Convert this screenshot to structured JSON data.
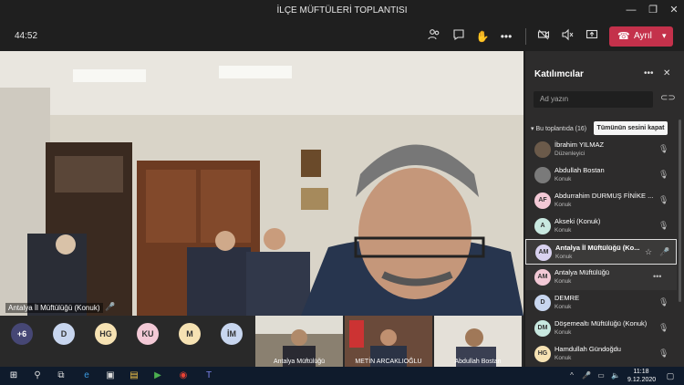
{
  "window": {
    "title": "İLÇE MÜFTÜLERİ TOPLANTISI"
  },
  "toolbar": {
    "timer": "44:52",
    "leave_label": "Ayrıl"
  },
  "stage": {
    "main_video_label": "Antalya İl Müftülüğü (Konuk)",
    "overflow_count": "+6",
    "bubbles": [
      {
        "initials": "D",
        "color": "#c8d6ef"
      },
      {
        "initials": "HG",
        "color": "#f6e2b3"
      },
      {
        "initials": "KU",
        "color": "#f3c9d6"
      },
      {
        "initials": "M",
        "color": "#f6e2b3"
      },
      {
        "initials": "İM",
        "color": "#c8d6ef"
      }
    ],
    "thumbnails": [
      {
        "label": "Antalya Müftülüğü"
      },
      {
        "label": "METİN ARCAKLIOĞLU"
      },
      {
        "label": "Abdullah Bostan"
      }
    ]
  },
  "panel": {
    "title": "Katılımcılar",
    "search_placeholder": "Ad yazın",
    "section_heading": "Bu toplantıda (16)",
    "mute_all_label": "Tümünün sesini kapat",
    "participants": [
      {
        "name": "İbrahim YILMAZ",
        "role": "Düzenleyici",
        "initials": "",
        "avatar_color": "#6b5a4a"
      },
      {
        "name": "Abdullah Bostan",
        "role": "Konuk",
        "initials": "",
        "avatar_color": "#7a7a7a"
      },
      {
        "name": "Abdurrahim DURMUŞ FİNİKE ...",
        "role": "Konuk",
        "initials": "AF",
        "avatar_color": "#f3c9d6"
      },
      {
        "name": "Akseki (Konuk)",
        "role": "Konuk",
        "initials": "A",
        "avatar_color": "#c8e8e0"
      },
      {
        "name": "Antalya İl Müftülüğü (Ko...",
        "role": "Konuk",
        "initials": "AM",
        "avatar_color": "#d9d2f0"
      },
      {
        "name": "Antalya Müftülüğü",
        "role": "Konuk",
        "initials": "AM",
        "avatar_color": "#f3c9d6"
      },
      {
        "name": "DEMRE",
        "role": "Konuk",
        "initials": "D",
        "avatar_color": "#c8d6ef"
      },
      {
        "name": "Döşemealtı Müftülüğü (Konuk)",
        "role": "Konuk",
        "initials": "DM",
        "avatar_color": "#c8e8e0"
      },
      {
        "name": "Hamdullah Gündoğdu",
        "role": "Konuk",
        "initials": "HG",
        "avatar_color": "#f6e2b3"
      }
    ]
  },
  "taskbar": {
    "time": "11:18",
    "date": "9.12.2020"
  }
}
